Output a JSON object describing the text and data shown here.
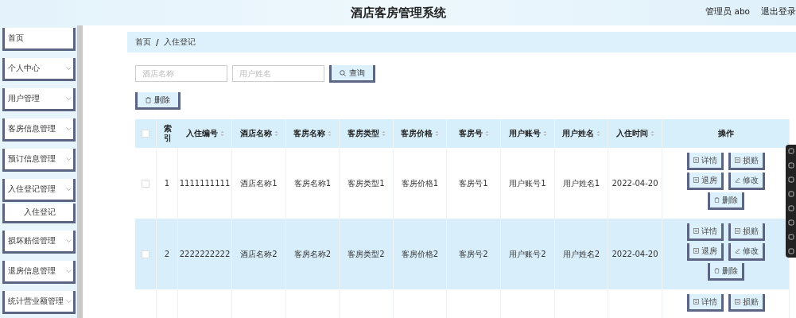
{
  "header": {
    "title": "酒店客房管理系统",
    "user": "管理员 abo",
    "logout": "退出登录"
  },
  "sidebar": {
    "items": [
      {
        "label": "首页",
        "has_arrow": false
      },
      {
        "label": "个人中心",
        "has_arrow": true
      },
      {
        "label": "用户管理",
        "has_arrow": true
      },
      {
        "label": "客房信息管理",
        "has_arrow": true
      },
      {
        "label": "预订信息管理",
        "has_arrow": true
      },
      {
        "label": "入住登记管理",
        "has_arrow": true,
        "children": [
          {
            "label": "入住登记"
          }
        ]
      },
      {
        "label": "损坏赔偿管理",
        "has_arrow": true
      },
      {
        "label": "退房信息管理",
        "has_arrow": true
      },
      {
        "label": "统计营业额管理",
        "has_arrow": true
      }
    ]
  },
  "breadcrumb": [
    "首页",
    "入住登记"
  ],
  "breadcrumb_separator": "/",
  "search": {
    "fields": [
      {
        "placeholder": "酒店名称"
      },
      {
        "placeholder": "用户姓名"
      }
    ],
    "button": "查询"
  },
  "delete_button": "删除",
  "table": {
    "header_checked": false,
    "columns": [
      {
        "label": "索引",
        "sortable": false
      },
      {
        "label": "入住编号",
        "sortable": true
      },
      {
        "label": "酒店名称",
        "sortable": true
      },
      {
        "label": "客房名称",
        "sortable": true
      },
      {
        "label": "客房类型",
        "sortable": true
      },
      {
        "label": "客房价格",
        "sortable": true
      },
      {
        "label": "客房号",
        "sortable": true
      },
      {
        "label": "用户账号",
        "sortable": true
      },
      {
        "label": "用户姓名",
        "sortable": true
      },
      {
        "label": "入住时间",
        "sortable": true
      },
      {
        "label": "操作",
        "sortable": false
      }
    ],
    "rows": [
      {
        "checked": false,
        "selected": false,
        "cells": [
          "1",
          "1111111111",
          "酒店名称1",
          "客房名称1",
          "客房类型1",
          "客房价格1",
          "客房号1",
          "用户账号1",
          "用户姓名1",
          "2022-04-20"
        ],
        "actions": [
          {
            "label": "详情",
            "kind": "doc"
          },
          {
            "label": "损赔",
            "kind": "doc"
          },
          {
            "label": "退房",
            "kind": "doc"
          },
          {
            "label": "修改",
            "kind": "edit"
          },
          {
            "label": "删除",
            "kind": "trash"
          }
        ]
      },
      {
        "checked": false,
        "selected": true,
        "cells": [
          "2",
          "2222222222",
          "酒店名称2",
          "客房名称2",
          "客房类型2",
          "客房价格2",
          "客房号2",
          "用户账号2",
          "用户姓名2",
          "2022-04-20"
        ],
        "actions": [
          {
            "label": "详情",
            "kind": "doc"
          },
          {
            "label": "损赔",
            "kind": "doc"
          },
          {
            "label": "退房",
            "kind": "doc"
          },
          {
            "label": "修改",
            "kind": "edit"
          },
          {
            "label": "删除",
            "kind": "trash"
          }
        ]
      },
      {
        "selected": false,
        "actions": [
          {
            "label": "详情",
            "kind": "doc"
          },
          {
            "label": "损赔",
            "kind": "doc"
          }
        ]
      }
    ]
  }
}
